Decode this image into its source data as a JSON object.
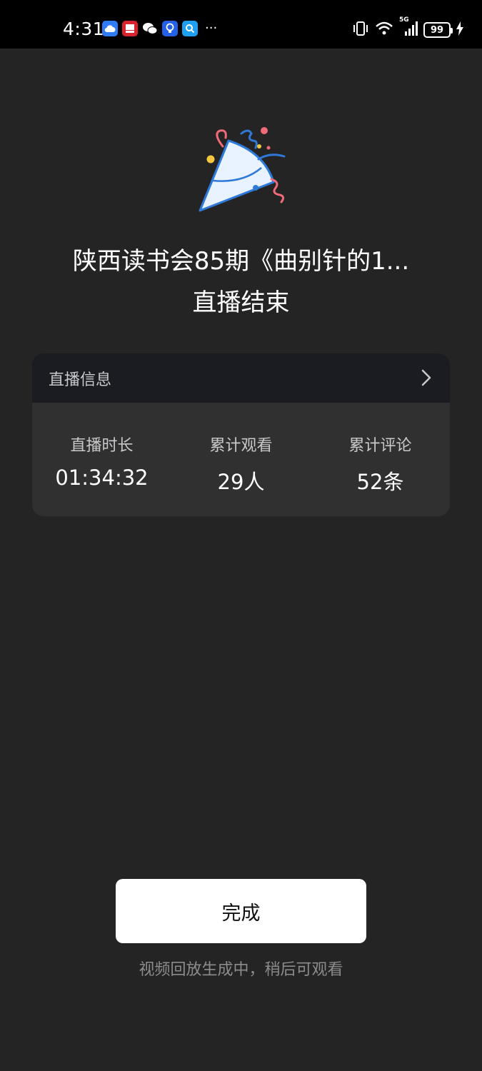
{
  "status_bar": {
    "time": "4:31",
    "more": "···",
    "battery": "99",
    "network": "5G",
    "apps": [
      "cloud-icon",
      "news-app-icon",
      "wechat-icon",
      "bulb-icon",
      "search-app-icon"
    ]
  },
  "header": {
    "title": "陕西读书会85期《曲别针的1...",
    "subtitle": "直播结束"
  },
  "info_card": {
    "heading": "直播信息",
    "stats": [
      {
        "label": "直播时长",
        "value": "01:34:32"
      },
      {
        "label": "累计观看",
        "value": "29人"
      },
      {
        "label": "累计评论",
        "value": "52条"
      }
    ]
  },
  "footer": {
    "done_label": "完成",
    "note": "视频回放生成中，稍后可观看"
  }
}
